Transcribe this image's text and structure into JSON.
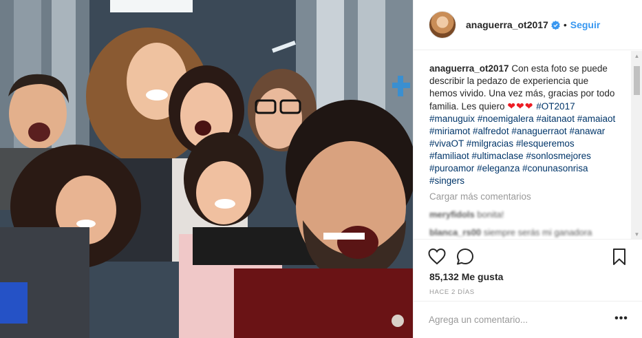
{
  "post": {
    "photo_icon": "group-selfie-photo",
    "colors": {
      "link": "#3897f0",
      "hashtag": "#003569",
      "muted": "#999999",
      "text": "#262626",
      "heart": "#ed1c24"
    }
  },
  "header": {
    "username": "anaguerra_ot2017",
    "verified_icon": "verified-badge-icon",
    "separator": "•",
    "follow_label": "Seguir"
  },
  "caption": {
    "username": "anaguerra_ot2017",
    "text": "Con esta foto se puede describir la pedazo de experiencia que hemos vivido. Una vez más, gracias por todo familia. Les quiero",
    "hearts": "❤❤❤",
    "hashtags": [
      "#OT2017",
      "#manuguix",
      "#noemigalera",
      "#aitanaot",
      "#amaiaot",
      "#miriamot",
      "#alfredot",
      "#anaguerraot",
      "#anawar",
      "#vivaOT",
      "#milgracias",
      "#lesqueremos",
      "#familiaot",
      "#ultimaclase",
      "#sonlosmejores",
      "#puroamor",
      "#eleganza",
      "#conunasonrisa",
      "#singers"
    ]
  },
  "load_more_label": "Cargar más comentarios",
  "comments": [
    {
      "user": "meryfidols",
      "text": "bonita!"
    },
    {
      "user": "blanca_rs00",
      "text": "siempre serás mi ganadora"
    },
    {
      "user": "",
      "text": ""
    }
  ],
  "actions": {
    "like_icon": "heart-outline-icon",
    "comment_icon": "comment-bubble-icon",
    "save_icon": "bookmark-icon"
  },
  "likes_label": "85,132 Me gusta",
  "time_label": "HACE 2 DÍAS",
  "add_comment": {
    "placeholder": "Agrega un comentario...",
    "more_label": "•••"
  }
}
